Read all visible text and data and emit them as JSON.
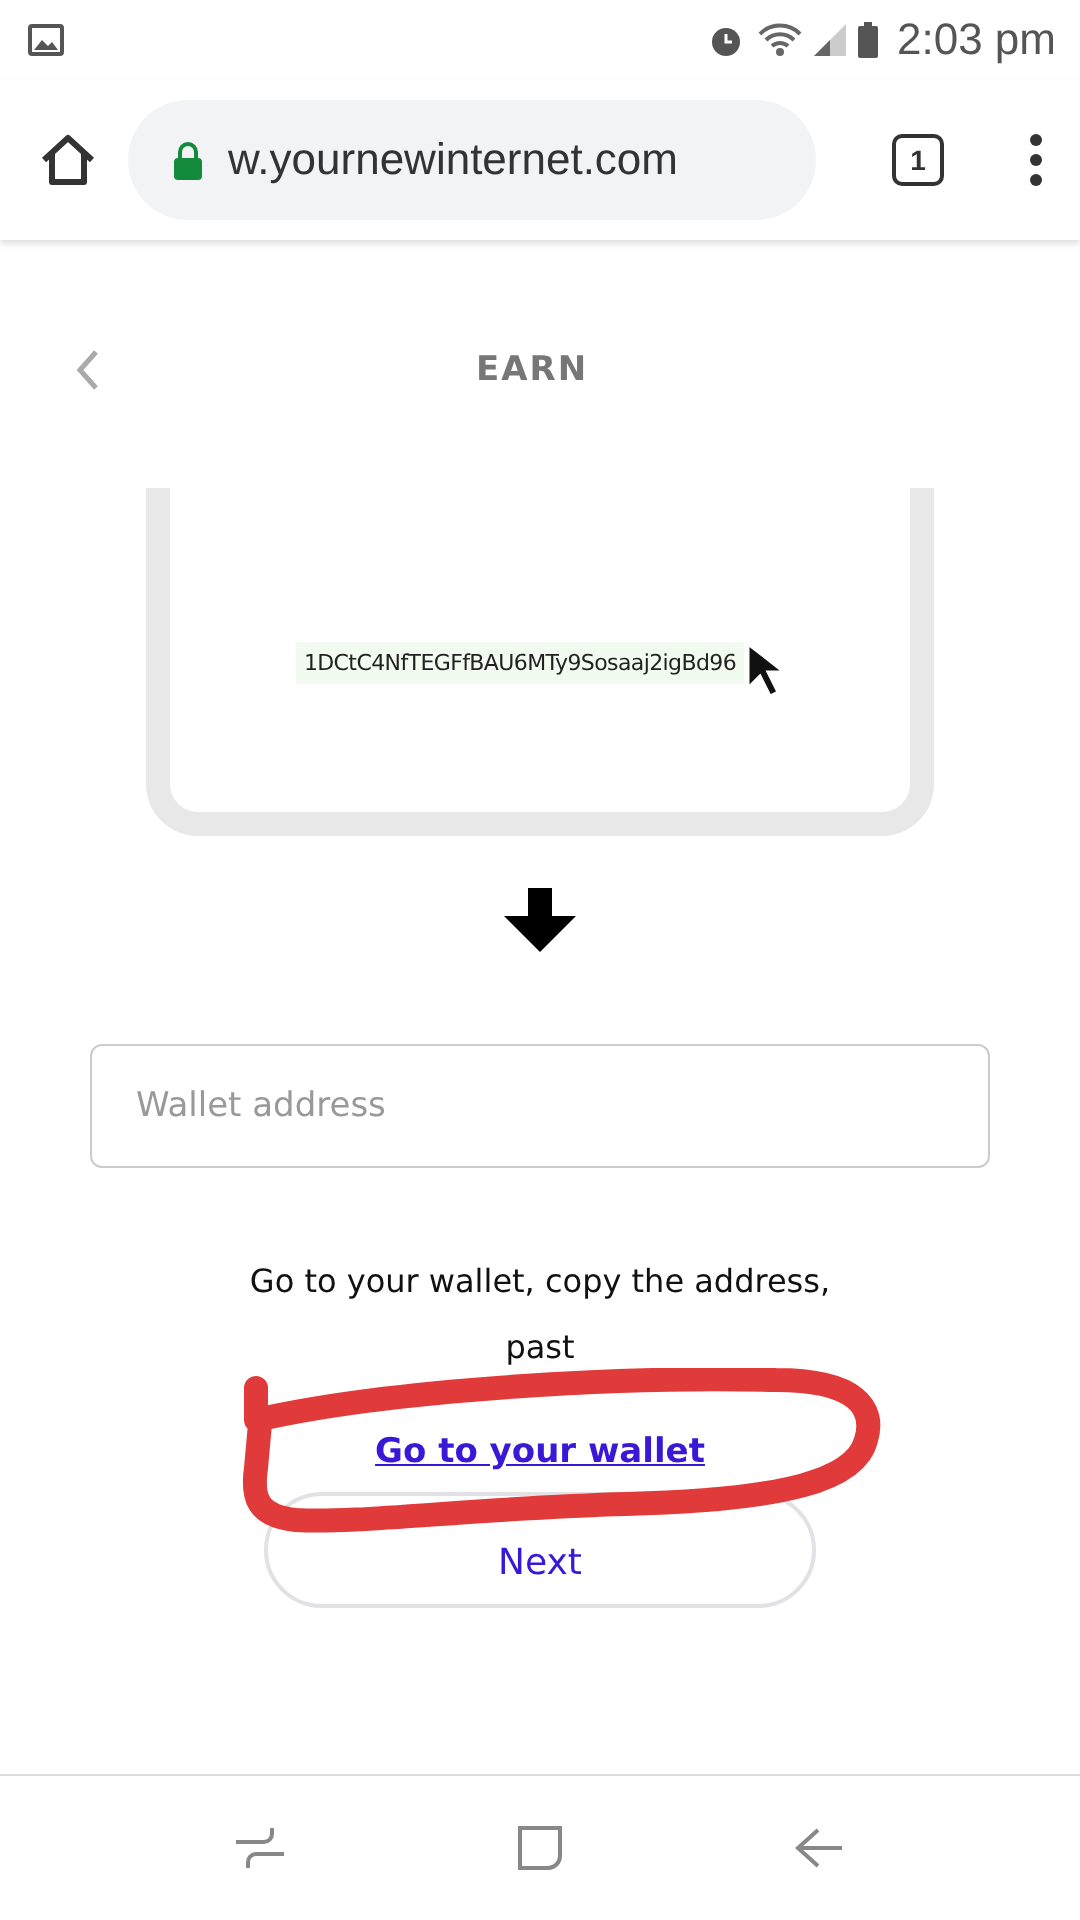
{
  "status_bar": {
    "time": "2:03 pm"
  },
  "browser": {
    "url": "w.yournewinternet.com",
    "tab_count": "1"
  },
  "header": {
    "title": "EARN"
  },
  "address_card": {
    "address": "1DCtC4NfTEGFfBAU6MTy9Sosaaj2igBd96"
  },
  "wallet_field": {
    "placeholder": "Wallet address"
  },
  "instruction": "Go to your wallet, copy the address, past",
  "link": "Go to your wallet",
  "next_button": "Next"
}
